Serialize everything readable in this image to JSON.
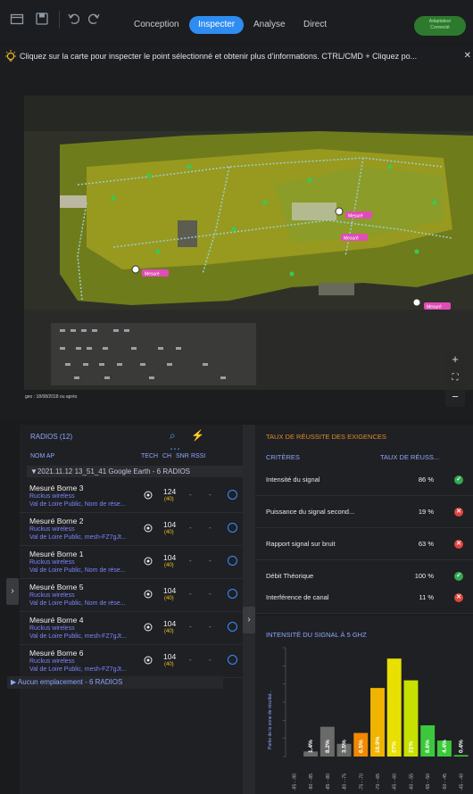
{
  "toolbar": {
    "tabs": [
      "Conception",
      "Inspecter",
      "Analyse",
      "Direct"
    ],
    "active_tab": "Inspecter",
    "status_line1": "Adaptateur",
    "status_line2": "Connecté"
  },
  "infobar": {
    "text": "Cliquez sur la carte pour inspecter le point sélectionné et obtenir plus d'informations. CTRL/CMD + Cliquez po...",
    "close": "✕"
  },
  "map": {
    "date_label": "geo : 18/08/2018 ou après",
    "tag_label": "Mesuré"
  },
  "radios": {
    "title": "RADIOS (12)",
    "columns": {
      "name": "NOM AP",
      "tech": "TECH",
      "ch": "CH",
      "snr": "SNR",
      "rssi": "RSSI"
    },
    "group": "▼2021.11.12 13_51_41 Google Earth - 6 RADIOS",
    "items": [
      {
        "name": "Mesuré Borne 3",
        "vendor": "Ruckus wireless",
        "detail": "Val de Loire Public, Nom de rése...",
        "ch": "124",
        "ch_sub": "(40)",
        "snr": "-",
        "rssi": "-"
      },
      {
        "name": "Mesuré Borne 2",
        "vendor": "Ruckus wireless",
        "detail": "Val de Loire Public, mesh-FZ7gJt...",
        "ch": "104",
        "ch_sub": "(40)",
        "snr": "-",
        "rssi": "-"
      },
      {
        "name": "Mesuré Borne 1",
        "vendor": "Ruckus wireless",
        "detail": "Val de Loire Public, Nom de rése...",
        "ch": "104",
        "ch_sub": "(40)",
        "snr": "-",
        "rssi": "-"
      },
      {
        "name": "Mesuré Borne 5",
        "vendor": "Ruckus wireless",
        "detail": "Val de Loire Public, Nom de rése...",
        "ch": "104",
        "ch_sub": "(40)",
        "snr": "-",
        "rssi": "-"
      },
      {
        "name": "Mesuré Borne 4",
        "vendor": "Ruckus wireless",
        "detail": "Val de Loire Public, mesh-FZ7gJt...",
        "ch": "104",
        "ch_sub": "(40)",
        "snr": "-",
        "rssi": "-"
      },
      {
        "name": "Mesuré Borne 6",
        "vendor": "Ruckus wireless",
        "detail": "Val de Loire Public, mesh-FZ7gJt...",
        "ch": "104",
        "ch_sub": "(40)",
        "snr": "-",
        "rssi": "-"
      }
    ],
    "no_location": "▶ Aucun emplacement - 6 RADIOS"
  },
  "requirements": {
    "title": "TAUX DE RÉUSSITE DES EXIGENCES",
    "col_criteria": "CRITÈRES",
    "col_rate": "TAUX DE RÉUSS...",
    "items": [
      {
        "label": "Intensité du signal",
        "value": "86 %",
        "status": "ok"
      },
      {
        "label": "Puissance du signal second...",
        "value": "19 %",
        "status": "ko"
      },
      {
        "label": "Rapport signal sur bruit",
        "value": "63 %",
        "status": "ko"
      },
      {
        "label": "Débit Théorique",
        "value": "100 %",
        "status": "ok"
      },
      {
        "label": "Interférence de canal",
        "value": "11 %",
        "status": "ko"
      }
    ]
  },
  "signal_chart": {
    "title": "INTENSITÉ DU SIGNAL À 5 GHZ",
    "ylabel": "Partie de la zone de résultat...",
    "colors": [
      "#6a6a6a",
      "#6a6a6a",
      "#6a6a6a",
      "#6a6a6a",
      "#f08a00",
      "#f0b400",
      "#e8e000",
      "#c8e000",
      "#3cc83c",
      "#3cc83c",
      "#3cc83c"
    ]
  },
  "chart_data": {
    "type": "bar",
    "title": "INTENSITÉ DU SIGNAL À 5 GHZ",
    "ylabel": "Partie de la zone de résultat...",
    "categories": [
      "-95 - -90",
      "-90 - -85",
      "-85 - -80",
      "-80 - -75",
      "-75 - -70",
      "-70 - -65",
      "-65 - -60",
      "-60 - -55",
      "-55 - -50",
      "-50 - -45",
      "-45 - -40"
    ],
    "values": [
      0,
      1.4,
      8.2,
      3.5,
      6.5,
      18.9,
      27,
      21,
      8.6,
      4.4,
      0.4
    ],
    "labels": [
      "",
      "1.4%",
      "8.2%",
      "3.5%",
      "6.5%",
      "18.9%",
      "27%",
      "21%",
      "8.6%",
      "4.4%",
      "0.4%"
    ],
    "ylim": [
      0,
      30
    ]
  }
}
